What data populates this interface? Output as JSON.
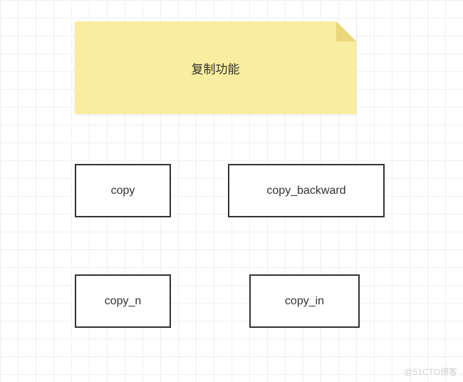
{
  "note": {
    "title": "复制功能"
  },
  "boxes": {
    "copy": "copy",
    "copy_backward": "copy_backward",
    "copy_n": "copy_n",
    "copy_in": "copy_in"
  },
  "watermark": "@51CTO博客"
}
